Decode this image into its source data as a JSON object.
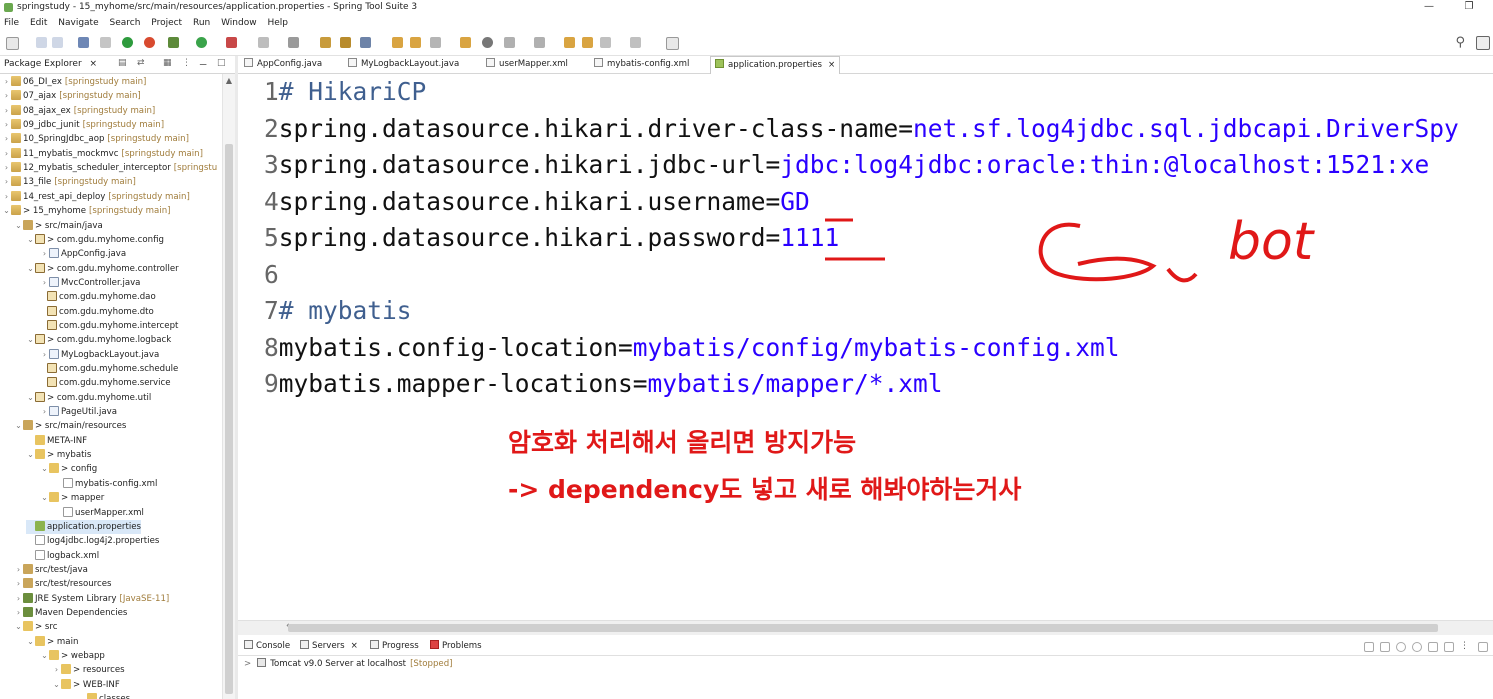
{
  "window": {
    "title": "springstudy - 15_myhome/src/main/resources/application.properties - Spring Tool Suite 3",
    "minimize": "—",
    "restore": "❐"
  },
  "menu": [
    "File",
    "Edit",
    "Navigate",
    "Search",
    "Project",
    "Run",
    "Window",
    "Help"
  ],
  "package_explorer": {
    "tab_label": "Package Explorer",
    "close": "×",
    "tree": [
      {
        "tw": ">",
        "label": "06_DI_ex",
        "deco": "[springstudy main]",
        "icon": "project"
      },
      {
        "tw": ">",
        "label": "07_ajax",
        "deco": "[springstudy main]",
        "icon": "project"
      },
      {
        "tw": ">",
        "label": "08_ajax_ex",
        "deco": "[springstudy main]",
        "icon": "project"
      },
      {
        "tw": ">",
        "label": "09_jdbc_junit",
        "deco": "[springstudy main]",
        "icon": "project"
      },
      {
        "tw": ">",
        "label": "10_SpringJdbc_aop",
        "deco": "[springstudy main]",
        "icon": "project"
      },
      {
        "tw": ">",
        "label": "11_mybatis_mockmvc",
        "deco": "[springstudy main]",
        "icon": "project"
      },
      {
        "tw": ">",
        "label": "12_mybatis_scheduler_interceptor",
        "deco": "[springstu",
        "icon": "project"
      },
      {
        "tw": ">",
        "label": "13_file",
        "deco": "[springstudy main]",
        "icon": "project"
      },
      {
        "tw": ">",
        "label": "14_rest_api_deploy",
        "deco": "[springstudy main]",
        "icon": "project"
      },
      {
        "tw": "v",
        "label": "> 15_myhome",
        "deco": "[springstudy main]",
        "icon": "project"
      },
      {
        "tw": "v",
        "label": "> src/main/java",
        "deco": "",
        "icon": "src"
      },
      {
        "tw": "v",
        "label": "> com.gdu.myhome.config",
        "deco": "",
        "icon": "pkg"
      },
      {
        "tw": ">",
        "label": "AppConfig.java",
        "deco": "",
        "icon": "java"
      },
      {
        "tw": "v",
        "label": "> com.gdu.myhome.controller",
        "deco": "",
        "icon": "pkg"
      },
      {
        "tw": ">",
        "label": "MvcController.java",
        "deco": "",
        "icon": "java"
      },
      {
        "tw": "",
        "label": "com.gdu.myhome.dao",
        "deco": "",
        "icon": "pkg"
      },
      {
        "tw": "",
        "label": "com.gdu.myhome.dto",
        "deco": "",
        "icon": "pkg"
      },
      {
        "tw": "",
        "label": "com.gdu.myhome.intercept",
        "deco": "",
        "icon": "pkg"
      },
      {
        "tw": "v",
        "label": "> com.gdu.myhome.logback",
        "deco": "",
        "icon": "pkg"
      },
      {
        "tw": ">",
        "label": "MyLogbackLayout.java",
        "deco": "",
        "icon": "java"
      },
      {
        "tw": "",
        "label": "com.gdu.myhome.schedule",
        "deco": "",
        "icon": "pkg"
      },
      {
        "tw": "",
        "label": "com.gdu.myhome.service",
        "deco": "",
        "icon": "pkg"
      },
      {
        "tw": "v",
        "label": "> com.gdu.myhome.util",
        "deco": "",
        "icon": "pkg"
      },
      {
        "tw": ">",
        "label": "PageUtil.java",
        "deco": "",
        "icon": "java"
      },
      {
        "tw": "v",
        "label": "> src/main/resources",
        "deco": "",
        "icon": "src"
      },
      {
        "tw": "",
        "label": "META-INF",
        "deco": "",
        "icon": "folder"
      },
      {
        "tw": "v",
        "label": "> mybatis",
        "deco": "",
        "icon": "folder"
      },
      {
        "tw": "v",
        "label": "> config",
        "deco": "",
        "icon": "folder"
      },
      {
        "tw": "",
        "label": "mybatis-config.xml",
        "deco": "",
        "icon": "xml"
      },
      {
        "tw": "v",
        "label": "> mapper",
        "deco": "",
        "icon": "folder"
      },
      {
        "tw": "",
        "label": "userMapper.xml",
        "deco": "",
        "icon": "xml"
      },
      {
        "tw": "",
        "label": "application.properties",
        "deco": "",
        "icon": "prop",
        "selected": true
      },
      {
        "tw": "",
        "label": "log4jdbc.log4j2.properties",
        "deco": "",
        "icon": "xml"
      },
      {
        "tw": "",
        "label": "logback.xml",
        "deco": "",
        "icon": "xml"
      },
      {
        "tw": ">",
        "label": "src/test/java",
        "deco": "",
        "icon": "src"
      },
      {
        "tw": ">",
        "label": "src/test/resources",
        "deco": "",
        "icon": "src"
      },
      {
        "tw": ">",
        "label": "JRE System Library",
        "deco": "[JavaSE-11]",
        "icon": "lib"
      },
      {
        "tw": ">",
        "label": "Maven Dependencies",
        "deco": "",
        "icon": "lib"
      },
      {
        "tw": "v",
        "label": "> src",
        "deco": "",
        "icon": "folder"
      },
      {
        "tw": "v",
        "label": "> main",
        "deco": "",
        "icon": "folder"
      },
      {
        "tw": "v",
        "label": "> webapp",
        "deco": "",
        "icon": "folder"
      },
      {
        "tw": ">",
        "label": "> resources",
        "deco": "",
        "icon": "folder"
      },
      {
        "tw": "v",
        "label": "> WEB-INF",
        "deco": "",
        "icon": "folder"
      },
      {
        "tw": "",
        "label": "classes",
        "deco": "",
        "icon": "folder"
      }
    ]
  },
  "editor_tabs": [
    {
      "label": "AppConfig.java",
      "active": false
    },
    {
      "label": "MyLogbackLayout.java",
      "active": false
    },
    {
      "label": "userMapper.xml",
      "active": false
    },
    {
      "label": "mybatis-config.xml",
      "active": false
    },
    {
      "label": "application.properties",
      "active": true,
      "close": "×"
    }
  ],
  "editor_lines": [
    {
      "n": "1",
      "key": "# HikariCP",
      "val": "",
      "comment": true
    },
    {
      "n": "2",
      "key": "spring.datasource.hikari.driver-class-name=",
      "val": "net.sf.log4jdbc.sql.jdbcapi.DriverSpy"
    },
    {
      "n": "3",
      "key": "spring.datasource.hikari.jdbc-url=",
      "val": "jdbc:log4jdbc:oracle:thin:@localhost:1521:xe"
    },
    {
      "n": "4",
      "key": "spring.datasource.hikari.username=",
      "val": "GD"
    },
    {
      "n": "5",
      "key": "spring.datasource.hikari.password=",
      "val": "1111"
    },
    {
      "n": "6",
      "key": "",
      "val": ""
    },
    {
      "n": "7",
      "key": "# mybatis",
      "val": "",
      "comment": true
    },
    {
      "n": "8",
      "key": "mybatis.config-location=",
      "val": "mybatis/config/mybatis-config.xml"
    },
    {
      "n": "9",
      "key": "mybatis.mapper-locations=",
      "val": "mybatis/mapper/*.xml"
    }
  ],
  "annotations": {
    "line1": "암호화 처리해서 올리면 방지가능",
    "line2": "-> dependency도 넣고 새로 해봐야하는거사",
    "handwriting": "bot",
    "color": "#e01818"
  },
  "bottom_panel": {
    "tabs": [
      "Console",
      "Servers",
      "Progress",
      "Problems"
    ],
    "active_tab": "Servers",
    "close": "×",
    "server_name": "Tomcat v9.0 Server at localhost",
    "server_state": "[Stopped]"
  }
}
